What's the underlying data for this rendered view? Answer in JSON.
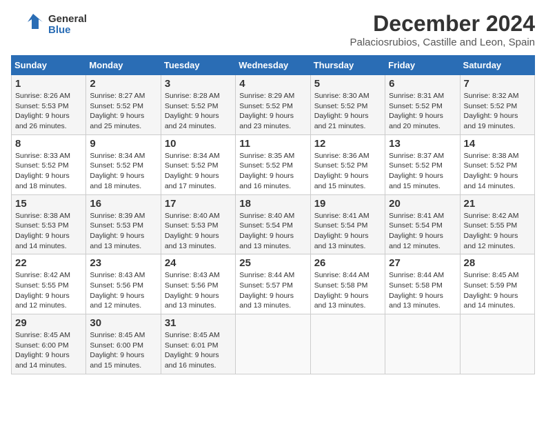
{
  "logo": {
    "general": "General",
    "blue": "Blue"
  },
  "header": {
    "title": "December 2024",
    "subtitle": "Palaciosrubios, Castille and Leon, Spain"
  },
  "weekdays": [
    "Sunday",
    "Monday",
    "Tuesday",
    "Wednesday",
    "Thursday",
    "Friday",
    "Saturday"
  ],
  "weeks": [
    [
      {
        "day": "1",
        "sunrise": "8:26 AM",
        "sunset": "5:53 PM",
        "daylight": "9 hours and 26 minutes."
      },
      {
        "day": "2",
        "sunrise": "8:27 AM",
        "sunset": "5:52 PM",
        "daylight": "9 hours and 25 minutes."
      },
      {
        "day": "3",
        "sunrise": "8:28 AM",
        "sunset": "5:52 PM",
        "daylight": "9 hours and 24 minutes."
      },
      {
        "day": "4",
        "sunrise": "8:29 AM",
        "sunset": "5:52 PM",
        "daylight": "9 hours and 23 minutes."
      },
      {
        "day": "5",
        "sunrise": "8:30 AM",
        "sunset": "5:52 PM",
        "daylight": "9 hours and 21 minutes."
      },
      {
        "day": "6",
        "sunrise": "8:31 AM",
        "sunset": "5:52 PM",
        "daylight": "9 hours and 20 minutes."
      },
      {
        "day": "7",
        "sunrise": "8:32 AM",
        "sunset": "5:52 PM",
        "daylight": "9 hours and 19 minutes."
      }
    ],
    [
      {
        "day": "8",
        "sunrise": "8:33 AM",
        "sunset": "5:52 PM",
        "daylight": "9 hours and 18 minutes."
      },
      {
        "day": "9",
        "sunrise": "8:34 AM",
        "sunset": "5:52 PM",
        "daylight": "9 hours and 18 minutes."
      },
      {
        "day": "10",
        "sunrise": "8:34 AM",
        "sunset": "5:52 PM",
        "daylight": "9 hours and 17 minutes."
      },
      {
        "day": "11",
        "sunrise": "8:35 AM",
        "sunset": "5:52 PM",
        "daylight": "9 hours and 16 minutes."
      },
      {
        "day": "12",
        "sunrise": "8:36 AM",
        "sunset": "5:52 PM",
        "daylight": "9 hours and 15 minutes."
      },
      {
        "day": "13",
        "sunrise": "8:37 AM",
        "sunset": "5:52 PM",
        "daylight": "9 hours and 15 minutes."
      },
      {
        "day": "14",
        "sunrise": "8:38 AM",
        "sunset": "5:52 PM",
        "daylight": "9 hours and 14 minutes."
      }
    ],
    [
      {
        "day": "15",
        "sunrise": "8:38 AM",
        "sunset": "5:53 PM",
        "daylight": "9 hours and 14 minutes."
      },
      {
        "day": "16",
        "sunrise": "8:39 AM",
        "sunset": "5:53 PM",
        "daylight": "9 hours and 13 minutes."
      },
      {
        "day": "17",
        "sunrise": "8:40 AM",
        "sunset": "5:53 PM",
        "daylight": "9 hours and 13 minutes."
      },
      {
        "day": "18",
        "sunrise": "8:40 AM",
        "sunset": "5:54 PM",
        "daylight": "9 hours and 13 minutes."
      },
      {
        "day": "19",
        "sunrise": "8:41 AM",
        "sunset": "5:54 PM",
        "daylight": "9 hours and 13 minutes."
      },
      {
        "day": "20",
        "sunrise": "8:41 AM",
        "sunset": "5:54 PM",
        "daylight": "9 hours and 12 minutes."
      },
      {
        "day": "21",
        "sunrise": "8:42 AM",
        "sunset": "5:55 PM",
        "daylight": "9 hours and 12 minutes."
      }
    ],
    [
      {
        "day": "22",
        "sunrise": "8:42 AM",
        "sunset": "5:55 PM",
        "daylight": "9 hours and 12 minutes."
      },
      {
        "day": "23",
        "sunrise": "8:43 AM",
        "sunset": "5:56 PM",
        "daylight": "9 hours and 12 minutes."
      },
      {
        "day": "24",
        "sunrise": "8:43 AM",
        "sunset": "5:56 PM",
        "daylight": "9 hours and 13 minutes."
      },
      {
        "day": "25",
        "sunrise": "8:44 AM",
        "sunset": "5:57 PM",
        "daylight": "9 hours and 13 minutes."
      },
      {
        "day": "26",
        "sunrise": "8:44 AM",
        "sunset": "5:58 PM",
        "daylight": "9 hours and 13 minutes."
      },
      {
        "day": "27",
        "sunrise": "8:44 AM",
        "sunset": "5:58 PM",
        "daylight": "9 hours and 13 minutes."
      },
      {
        "day": "28",
        "sunrise": "8:45 AM",
        "sunset": "5:59 PM",
        "daylight": "9 hours and 14 minutes."
      }
    ],
    [
      {
        "day": "29",
        "sunrise": "8:45 AM",
        "sunset": "6:00 PM",
        "daylight": "9 hours and 14 minutes."
      },
      {
        "day": "30",
        "sunrise": "8:45 AM",
        "sunset": "6:00 PM",
        "daylight": "9 hours and 15 minutes."
      },
      {
        "day": "31",
        "sunrise": "8:45 AM",
        "sunset": "6:01 PM",
        "daylight": "9 hours and 16 minutes."
      },
      null,
      null,
      null,
      null
    ]
  ],
  "labels": {
    "sunrise": "Sunrise:",
    "sunset": "Sunset:",
    "daylight": "Daylight:"
  }
}
